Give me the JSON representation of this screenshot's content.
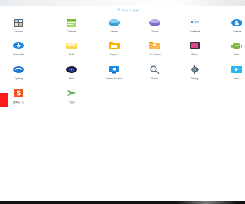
{
  "search": {
    "label": "Search Apps"
  },
  "apps": [
    {
      "label": "Calculator"
    },
    {
      "label": "Calendar"
    },
    {
      "label": "Camera"
    },
    {
      "label": "Chrome"
    },
    {
      "label": "CoffeeNet"
    },
    {
      "label": "Contacts"
    },
    {
      "label": "Downloads"
    },
    {
      "label": "Email"
    },
    {
      "label": "Explorer"
    },
    {
      "label": "File Explorer"
    },
    {
      "label": "Gallery"
    },
    {
      "label": "Install"
    },
    {
      "label": "Lightning"
    },
    {
      "label": "Music"
    },
    {
      "label": "Screen Recorder"
    },
    {
      "label": "Search"
    },
    {
      "label": "Settings"
    },
    {
      "label": "Video"
    },
    {
      "label": "搜狗输入法"
    },
    {
      "label": "飞如米"
    }
  ]
}
